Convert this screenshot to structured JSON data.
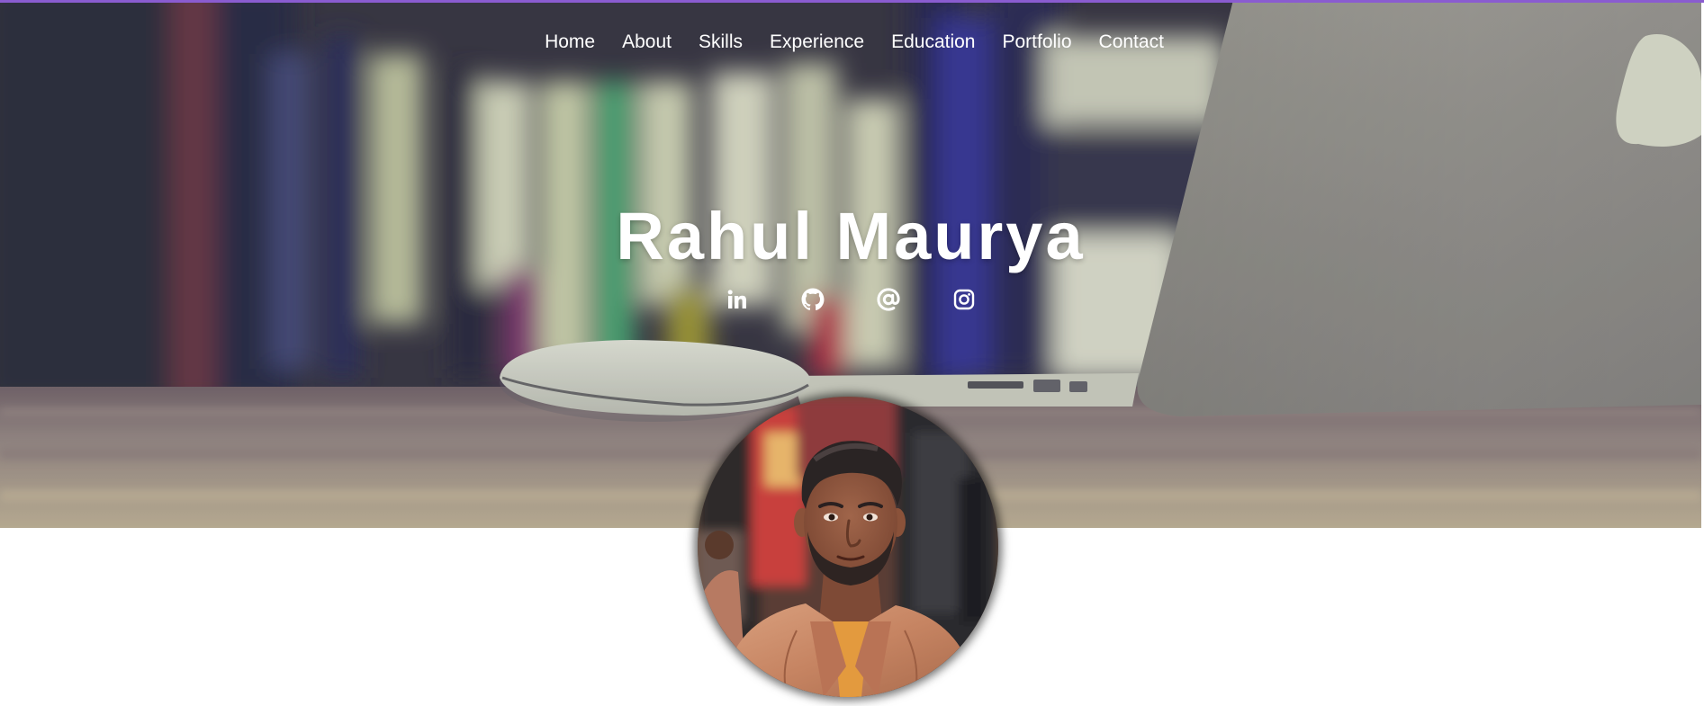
{
  "colors": {
    "accent_bar": "#8a5cd0",
    "nav_text": "#ffffff",
    "title_text": "#ffffff",
    "page_background": "#ffffff"
  },
  "nav": {
    "items": [
      {
        "label": "Home"
      },
      {
        "label": "About"
      },
      {
        "label": "Skills"
      },
      {
        "label": "Experience"
      },
      {
        "label": "Education"
      },
      {
        "label": "Portfolio"
      },
      {
        "label": "Contact"
      }
    ]
  },
  "hero": {
    "name": "Rahul Maurya",
    "background": "blurred-bookshelf-desk-laptop-mouse-photo"
  },
  "social": [
    {
      "icon": "linkedin-icon"
    },
    {
      "icon": "github-icon"
    },
    {
      "icon": "email-at-icon"
    },
    {
      "icon": "instagram-icon"
    }
  ],
  "profile": {
    "photo": "profile-photo-of-man-in-tan-leather-jacket"
  }
}
